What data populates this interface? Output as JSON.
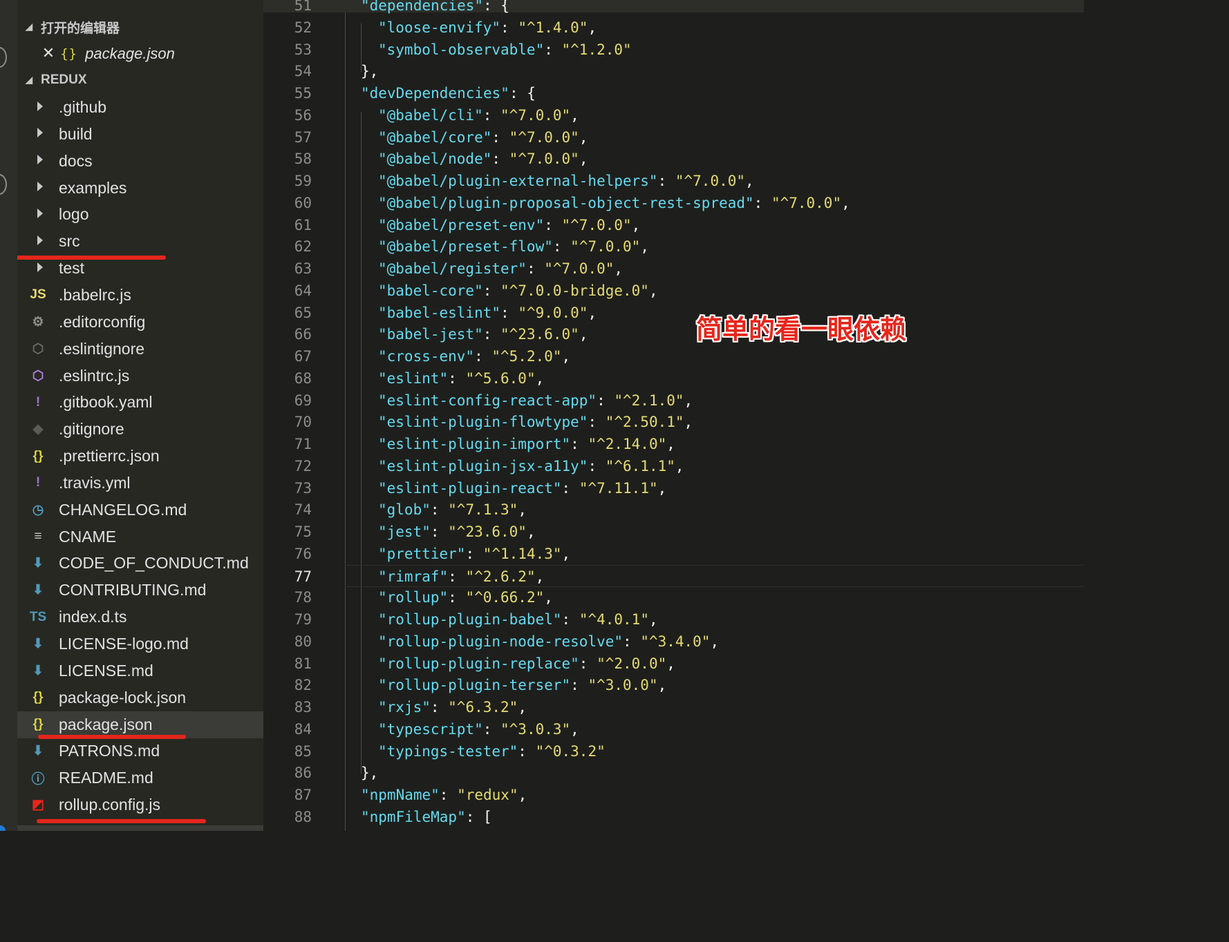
{
  "sidebar": {
    "open_editors": {
      "header": "打开的编辑器",
      "items": [
        {
          "close_icon": "✕",
          "icon": "{}",
          "name": "package.json"
        }
      ]
    },
    "project": {
      "header": "REDUX",
      "items": [
        {
          "name": ".github",
          "type": "folder",
          "icon": "folder-closed-icon"
        },
        {
          "name": "build",
          "type": "folder",
          "icon": "folder-closed-icon"
        },
        {
          "name": "docs",
          "type": "folder",
          "icon": "folder-closed-icon"
        },
        {
          "name": "examples",
          "type": "folder",
          "icon": "folder-closed-icon"
        },
        {
          "name": "logo",
          "type": "folder",
          "icon": "folder-closed-icon"
        },
        {
          "name": "src",
          "type": "folder",
          "icon": "folder-closed-icon"
        },
        {
          "name": "test",
          "type": "folder",
          "icon": "folder-closed-icon"
        },
        {
          "name": ".babelrc.js",
          "type": "file",
          "icon": "js-icon",
          "glyph": "JS",
          "color": "#e6db74"
        },
        {
          "name": ".editorconfig",
          "type": "file",
          "icon": "gear-icon",
          "glyph": "⚙",
          "color": "#8d8e89"
        },
        {
          "name": ".eslintignore",
          "type": "file",
          "icon": "eslint-icon",
          "glyph": "⬡",
          "color": "#6c6d68"
        },
        {
          "name": ".eslintrc.js",
          "type": "file",
          "icon": "eslint-icon",
          "glyph": "⬡",
          "color": "#b082e6"
        },
        {
          "name": ".gitbook.yaml",
          "type": "file",
          "icon": "yaml-icon",
          "glyph": "!",
          "color": "#a66ee6"
        },
        {
          "name": ".gitignore",
          "type": "file",
          "icon": "git-icon",
          "glyph": "◆",
          "color": "#5a5b56"
        },
        {
          "name": ".prettierrc.json",
          "type": "file",
          "icon": "json-icon",
          "glyph": "{}",
          "color": "#d8d14e"
        },
        {
          "name": ".travis.yml",
          "type": "file",
          "icon": "yaml-icon",
          "glyph": "!",
          "color": "#a66ee6"
        },
        {
          "name": "CHANGELOG.md",
          "type": "file",
          "icon": "clock-icon",
          "glyph": "◷",
          "color": "#519aba"
        },
        {
          "name": "CNAME",
          "type": "file",
          "icon": "text-lines-icon",
          "glyph": "≡",
          "color": "#c8c8c8"
        },
        {
          "name": "CODE_OF_CONDUCT.md",
          "type": "file",
          "icon": "markdown-icon",
          "glyph": "⬇",
          "color": "#519aba"
        },
        {
          "name": "CONTRIBUTING.md",
          "type": "file",
          "icon": "markdown-icon",
          "glyph": "⬇",
          "color": "#519aba"
        },
        {
          "name": "index.d.ts",
          "type": "file",
          "icon": "typescript-icon",
          "glyph": "TS",
          "color": "#519aba"
        },
        {
          "name": "LICENSE-logo.md",
          "type": "file",
          "icon": "markdown-icon",
          "glyph": "⬇",
          "color": "#519aba"
        },
        {
          "name": "LICENSE.md",
          "type": "file",
          "icon": "markdown-icon",
          "glyph": "⬇",
          "color": "#519aba"
        },
        {
          "name": "package-lock.json",
          "type": "file",
          "icon": "json-icon",
          "glyph": "{}",
          "color": "#d8d14e"
        },
        {
          "name": "package.json",
          "type": "file",
          "icon": "json-icon",
          "glyph": "{}",
          "color": "#d8d14e",
          "selected": true
        },
        {
          "name": "PATRONS.md",
          "type": "file",
          "icon": "markdown-icon",
          "glyph": "⬇",
          "color": "#519aba"
        },
        {
          "name": "README.md",
          "type": "file",
          "icon": "info-icon",
          "glyph": "ⓘ",
          "color": "#519aba"
        },
        {
          "name": "rollup.config.js",
          "type": "file",
          "icon": "rollup-icon",
          "glyph": "◩",
          "color": "#e5261b"
        }
      ]
    }
  },
  "editor": {
    "lines": [
      {
        "n": "51",
        "t": "\"dependencies\": {",
        "indent": 1,
        "kind": "key"
      },
      {
        "n": "52",
        "t": "\"loose-envify\": \"^1.4.0\",",
        "indent": 2
      },
      {
        "n": "53",
        "t": "\"symbol-observable\": \"^1.2.0\"",
        "indent": 2
      },
      {
        "n": "54",
        "t": "},",
        "indent": 1,
        "kind": "punct"
      },
      {
        "n": "55",
        "t": "\"devDependencies\": {",
        "indent": 1,
        "kind": "key"
      },
      {
        "n": "56",
        "t": "\"@babel/cli\": \"^7.0.0\",",
        "indent": 2
      },
      {
        "n": "57",
        "t": "\"@babel/core\": \"^7.0.0\",",
        "indent": 2
      },
      {
        "n": "58",
        "t": "\"@babel/node\": \"^7.0.0\",",
        "indent": 2
      },
      {
        "n": "59",
        "t": "\"@babel/plugin-external-helpers\": \"^7.0.0\",",
        "indent": 2
      },
      {
        "n": "60",
        "t": "\"@babel/plugin-proposal-object-rest-spread\": \"^7.0.0\",",
        "indent": 2
      },
      {
        "n": "61",
        "t": "\"@babel/preset-env\": \"^7.0.0\",",
        "indent": 2
      },
      {
        "n": "62",
        "t": "\"@babel/preset-flow\": \"^7.0.0\",",
        "indent": 2
      },
      {
        "n": "63",
        "t": "\"@babel/register\": \"^7.0.0\",",
        "indent": 2
      },
      {
        "n": "64",
        "t": "\"babel-core\": \"^7.0.0-bridge.0\",",
        "indent": 2
      },
      {
        "n": "65",
        "t": "\"babel-eslint\": \"^9.0.0\",",
        "indent": 2
      },
      {
        "n": "66",
        "t": "\"babel-jest\": \"^23.6.0\",",
        "indent": 2
      },
      {
        "n": "67",
        "t": "\"cross-env\": \"^5.2.0\",",
        "indent": 2
      },
      {
        "n": "68",
        "t": "\"eslint\": \"^5.6.0\",",
        "indent": 2
      },
      {
        "n": "69",
        "t": "\"eslint-config-react-app\": \"^2.1.0\",",
        "indent": 2
      },
      {
        "n": "70",
        "t": "\"eslint-plugin-flowtype\": \"^2.50.1\",",
        "indent": 2
      },
      {
        "n": "71",
        "t": "\"eslint-plugin-import\": \"^2.14.0\",",
        "indent": 2
      },
      {
        "n": "72",
        "t": "\"eslint-plugin-jsx-a11y\": \"^6.1.1\",",
        "indent": 2
      },
      {
        "n": "73",
        "t": "\"eslint-plugin-react\": \"^7.11.1\",",
        "indent": 2
      },
      {
        "n": "74",
        "t": "\"glob\": \"^7.1.3\",",
        "indent": 2
      },
      {
        "n": "75",
        "t": "\"jest\": \"^23.6.0\",",
        "indent": 2
      },
      {
        "n": "76",
        "t": "\"prettier\": \"^1.14.3\",",
        "indent": 2
      },
      {
        "n": "77",
        "t": "\"rimraf\": \"^2.6.2\",",
        "indent": 2,
        "current": true
      },
      {
        "n": "78",
        "t": "\"rollup\": \"^0.66.2\",",
        "indent": 2
      },
      {
        "n": "79",
        "t": "\"rollup-plugin-babel\": \"^4.0.1\",",
        "indent": 2
      },
      {
        "n": "80",
        "t": "\"rollup-plugin-node-resolve\": \"^3.4.0\",",
        "indent": 2
      },
      {
        "n": "81",
        "t": "\"rollup-plugin-replace\": \"^2.0.0\",",
        "indent": 2
      },
      {
        "n": "82",
        "t": "\"rollup-plugin-terser\": \"^3.0.0\",",
        "indent": 2
      },
      {
        "n": "83",
        "t": "\"rxjs\": \"^6.3.2\",",
        "indent": 2
      },
      {
        "n": "84",
        "t": "\"typescript\": \"^3.0.3\",",
        "indent": 2
      },
      {
        "n": "85",
        "t": "\"typings-tester\": \"^0.3.2\"",
        "indent": 2
      },
      {
        "n": "86",
        "t": "},",
        "indent": 1,
        "kind": "punct"
      },
      {
        "n": "87",
        "t": "\"npmName\": \"redux\",",
        "indent": 1
      },
      {
        "n": "88",
        "t": "\"npmFileMap\": [",
        "indent": 1,
        "kind": "key"
      }
    ]
  },
  "annotation": "简单的看一眼依赖",
  "colors": {
    "accent_red": "#e5261b",
    "key_blue": "#66d9ef",
    "string_yellow": "#e6db74"
  }
}
